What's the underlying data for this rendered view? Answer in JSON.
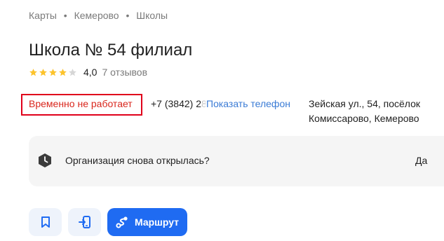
{
  "breadcrumb": {
    "items": [
      "Карты",
      "Кемерово",
      "Школы"
    ],
    "separator": "•"
  },
  "org": {
    "title": "Школа № 54 филиал",
    "rating_value": "4,0",
    "rating_stars": 4,
    "rating_max": 5,
    "reviews": "7 отзывов"
  },
  "status": {
    "text": "Временно не работает",
    "color": "#d9261c",
    "highlight_color": "#e0001b"
  },
  "contacts": {
    "phone_visible": "+7 (3842) 2",
    "phone_faded": "8",
    "show_phone_label": "Показать телефон",
    "address_line1": "Зейская ул., 54, посёлок",
    "address_line2": "Комиссарово, Кемерово"
  },
  "reopen": {
    "question": "Организация снова открылась?",
    "yes_label": "Да",
    "icon": "clock-icon"
  },
  "actions": {
    "bookmark_icon": "bookmark-icon",
    "send_icon": "send-to-phone-icon",
    "route_label": "Маршрут",
    "route_icon": "route-icon",
    "accent": "#1f6bf2",
    "secondary_bg": "#eef3fb"
  },
  "colors": {
    "star_filled": "#fcc32c",
    "star_empty": "#d6d6d6"
  }
}
